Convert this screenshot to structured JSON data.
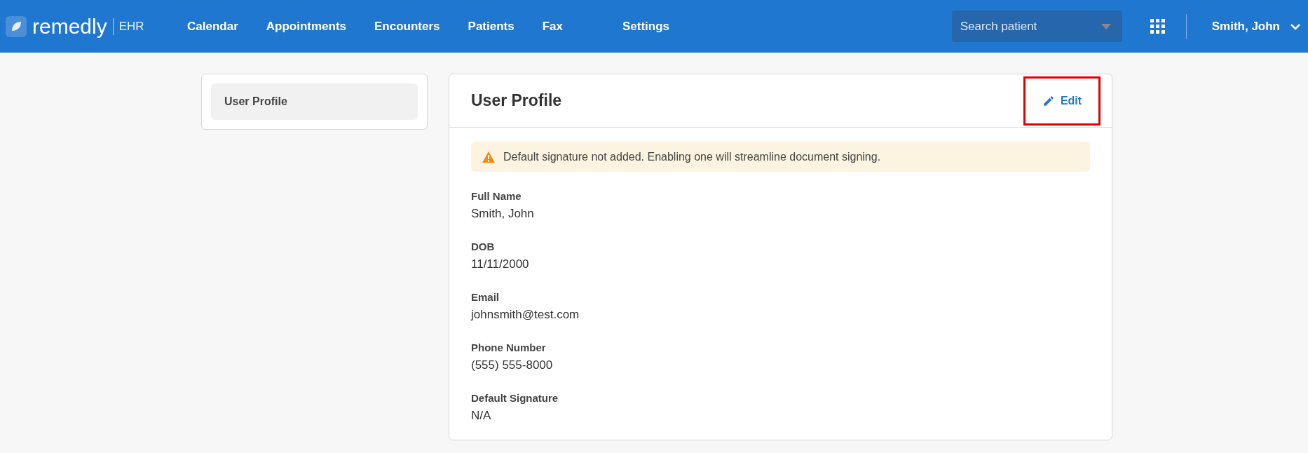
{
  "brand": {
    "name": "remedly",
    "product": "EHR"
  },
  "nav": [
    {
      "label": "Calendar"
    },
    {
      "label": "Appointments"
    },
    {
      "label": "Encounters"
    },
    {
      "label": "Patients"
    },
    {
      "label": "Fax"
    },
    {
      "label": "Settings"
    }
  ],
  "search": {
    "placeholder": "Search patient"
  },
  "user": {
    "name": "Smith, John"
  },
  "sidebar": {
    "items": [
      {
        "label": "User Profile",
        "selected": true
      }
    ]
  },
  "profile": {
    "title": "User Profile",
    "edit_button": {
      "label": "Edit",
      "highlighted": true
    },
    "alert": {
      "text": "Default signature not added. Enabling one will streamline document signing."
    },
    "fields": [
      {
        "label": "Full Name",
        "value": "Smith, John"
      },
      {
        "label": "DOB",
        "value": "11/11/2000"
      },
      {
        "label": "Email",
        "value": "johnsmith@test.com"
      },
      {
        "label": "Phone Number",
        "value": "(555) 555-8000"
      },
      {
        "label": "Default Signature",
        "value": "N/A"
      }
    ]
  }
}
